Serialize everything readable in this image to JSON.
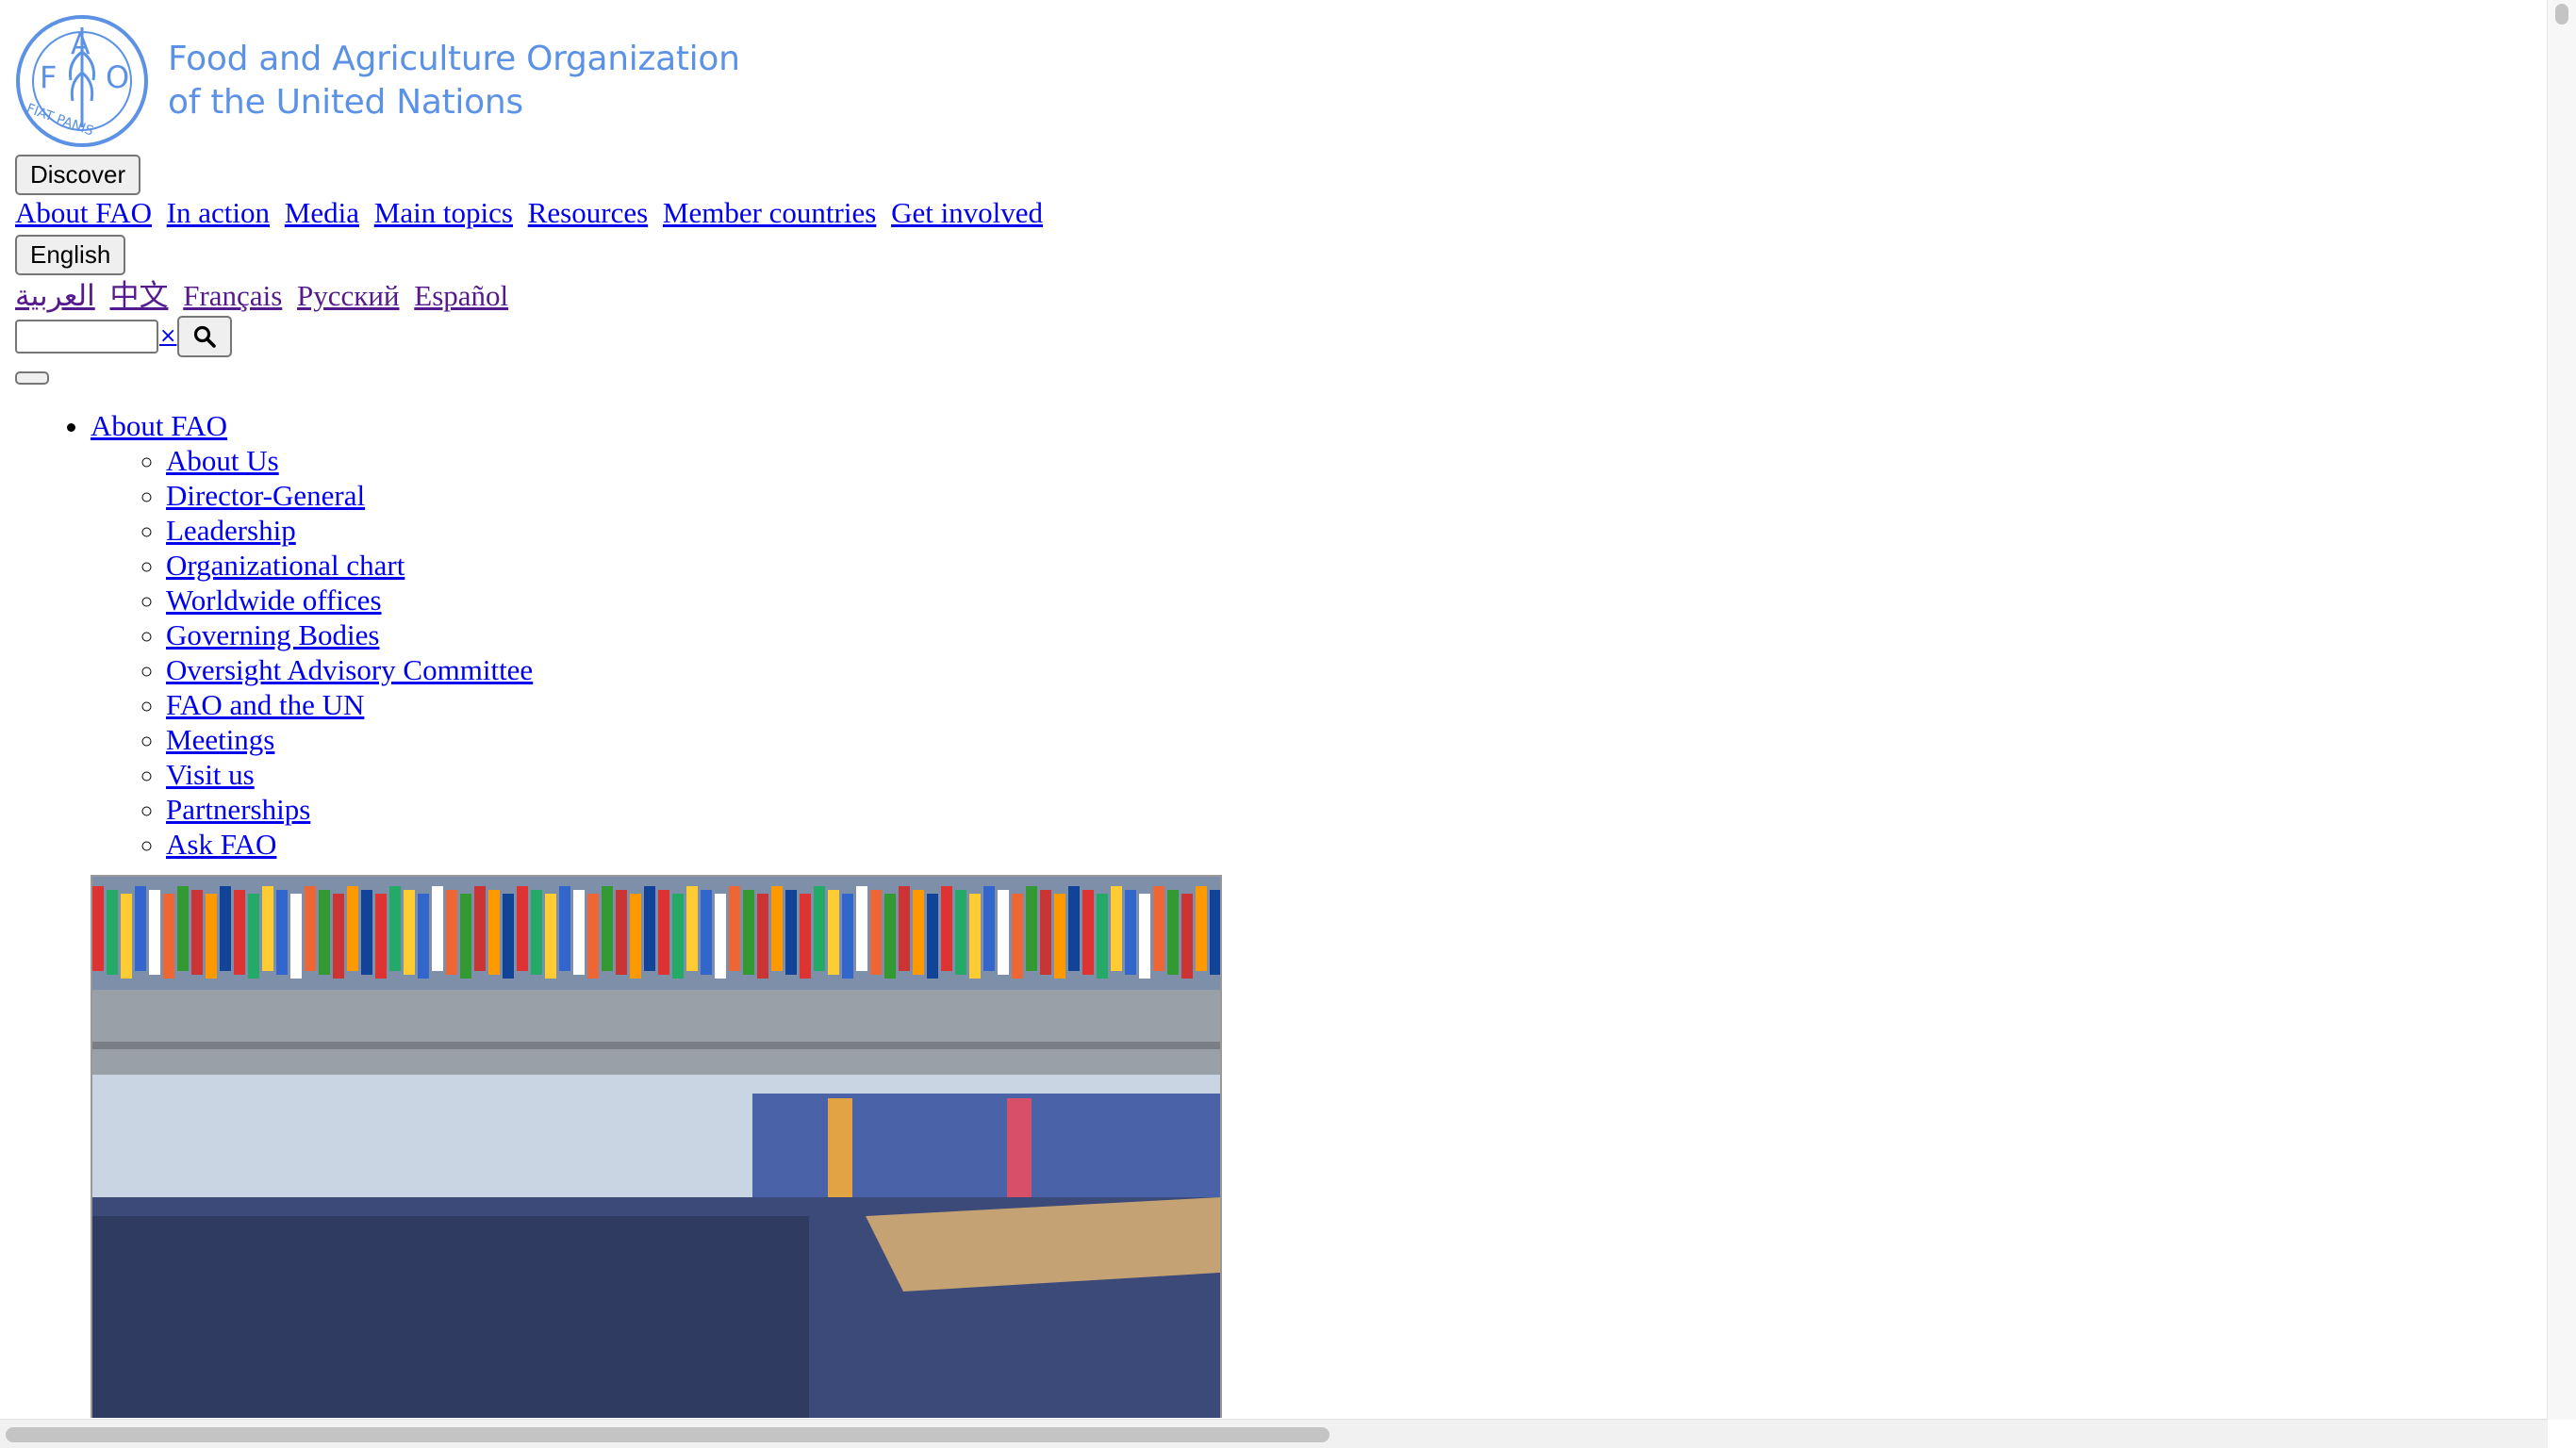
{
  "header": {
    "org_name_line1": "Food and Agriculture Organization",
    "org_name_line2": "of the United Nations",
    "logo": {
      "letters": [
        "F",
        "A",
        "O"
      ],
      "motto": "FIAT PANIS",
      "color": "#5b92e5"
    }
  },
  "discover_button": "Discover",
  "nav": [
    "About FAO",
    "In action",
    "Media",
    "Main topics",
    "Resources",
    "Member countries",
    "Get involved"
  ],
  "language_button": "English",
  "languages": [
    "العربية",
    "中文",
    "Français",
    "Русский",
    "Español"
  ],
  "search": {
    "value": "",
    "clear_label": "×",
    "icon": "search-icon"
  },
  "menu": {
    "top_label": "About FAO",
    "items": [
      "About Us",
      "Director-General",
      "Leadership",
      "Organizational chart",
      "Worldwide offices",
      "Governing Bodies",
      "Oversight Advisory Committee",
      "FAO and the UN",
      "Meetings",
      "Visit us",
      "Partnerships",
      "Ask FAO"
    ]
  },
  "hero_image": {
    "icon": "conference-hall-photo"
  },
  "colors": {
    "brand": "#5b92e5",
    "link": "#0000ee",
    "visited_link": "#551a8b"
  }
}
